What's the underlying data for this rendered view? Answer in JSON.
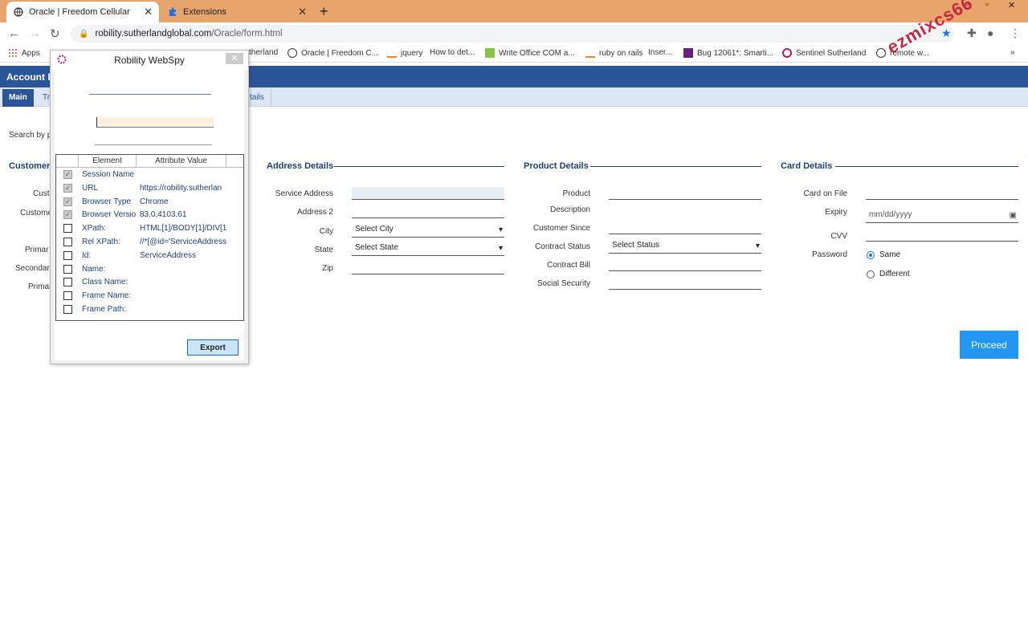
{
  "browser": {
    "tabs": [
      {
        "title": "Oracle | Freedom Cellular"
      },
      {
        "title": "Extensions"
      }
    ],
    "url_host": "robility.sutherlandglobal.com",
    "url_path": "/Oracle/form.html",
    "bookmarks": [
      {
        "label": "Apps"
      },
      {
        "label": "therland"
      },
      {
        "label": "Oracle | Freedom C..."
      },
      {
        "label": "jquery"
      },
      {
        "label": "How to det..."
      },
      {
        "label": "Write Office COM a..."
      },
      {
        "label": "ruby on rails"
      },
      {
        "label": "Inser..."
      },
      {
        "label": "Bug 12061*: Smarti..."
      },
      {
        "label": "Sentinel Sutherland"
      },
      {
        "label": "remote w..."
      }
    ]
  },
  "app": {
    "header_title": "Account D",
    "tabs": [
      {
        "label": "Main"
      },
      {
        "label": "Tr"
      },
      {
        "label": "tails"
      }
    ],
    "search_label": "Search by p",
    "customer": {
      "title": "Customer",
      "labels": [
        "Cust",
        "Custome",
        "Primar",
        "Secondary",
        "Primar"
      ]
    },
    "address": {
      "title": "Address Details",
      "service_address_label": "Service Address",
      "address2_label": "Address 2",
      "city_label": "City",
      "city_value": "Select City",
      "state_label": "State",
      "state_value": "Select State",
      "zip_label": "Zip"
    },
    "product": {
      "title": "Product Details",
      "product_label": "Product",
      "description_label": "Description",
      "customer_since_label": "Customer Since",
      "contract_status_label": "Contract Status",
      "contract_status_value": "Select Status",
      "contract_bill_label": "Contract Bill",
      "social_security_label": "Social Security"
    },
    "card": {
      "title": "Card Details",
      "card_on_file_label": "Card on File",
      "expiry_label": "Expiry",
      "expiry_placeholder": "mm/dd/yyyy",
      "cvv_label": "CVV",
      "password_label": "Password",
      "radio_same": "Same",
      "radio_different": "Different"
    },
    "proceed_label": "Proceed"
  },
  "webspy": {
    "title": "Robility WebSpy",
    "col_element": "Element",
    "col_value": "Attribute Value",
    "rows": [
      {
        "element": "Session Name",
        "value": "",
        "checked": "true"
      },
      {
        "element": "URL",
        "value": "https://robility.sutherlan",
        "checked": "true"
      },
      {
        "element": "Browser Type",
        "value": "Chrome",
        "checked": "true"
      },
      {
        "element": "Browser Versio",
        "value": "83.0.4103.61",
        "checked": "true"
      },
      {
        "element": "XPath:",
        "value": "HTML[1]/BODY[1]/DIV[1",
        "checked": "false"
      },
      {
        "element": "Rel XPath:",
        "value": "//*[@id='ServiceAddress",
        "checked": "false"
      },
      {
        "element": "Id:",
        "value": "ServiceAddress",
        "checked": "false"
      },
      {
        "element": "Name:",
        "value": "",
        "checked": "false"
      },
      {
        "element": "Class Name:",
        "value": "",
        "checked": "false"
      },
      {
        "element": "Frame Name:",
        "value": "",
        "checked": "false"
      },
      {
        "element": "Frame Path:",
        "value": "",
        "checked": "false"
      }
    ],
    "export_label": "Export"
  },
  "watermark": "ezmixcs66",
  "colors": {
    "tabstrip": "#e8a56b",
    "app_header": "#2a5599",
    "proceed": "#2196f3",
    "watermark": "#c41f3e"
  }
}
